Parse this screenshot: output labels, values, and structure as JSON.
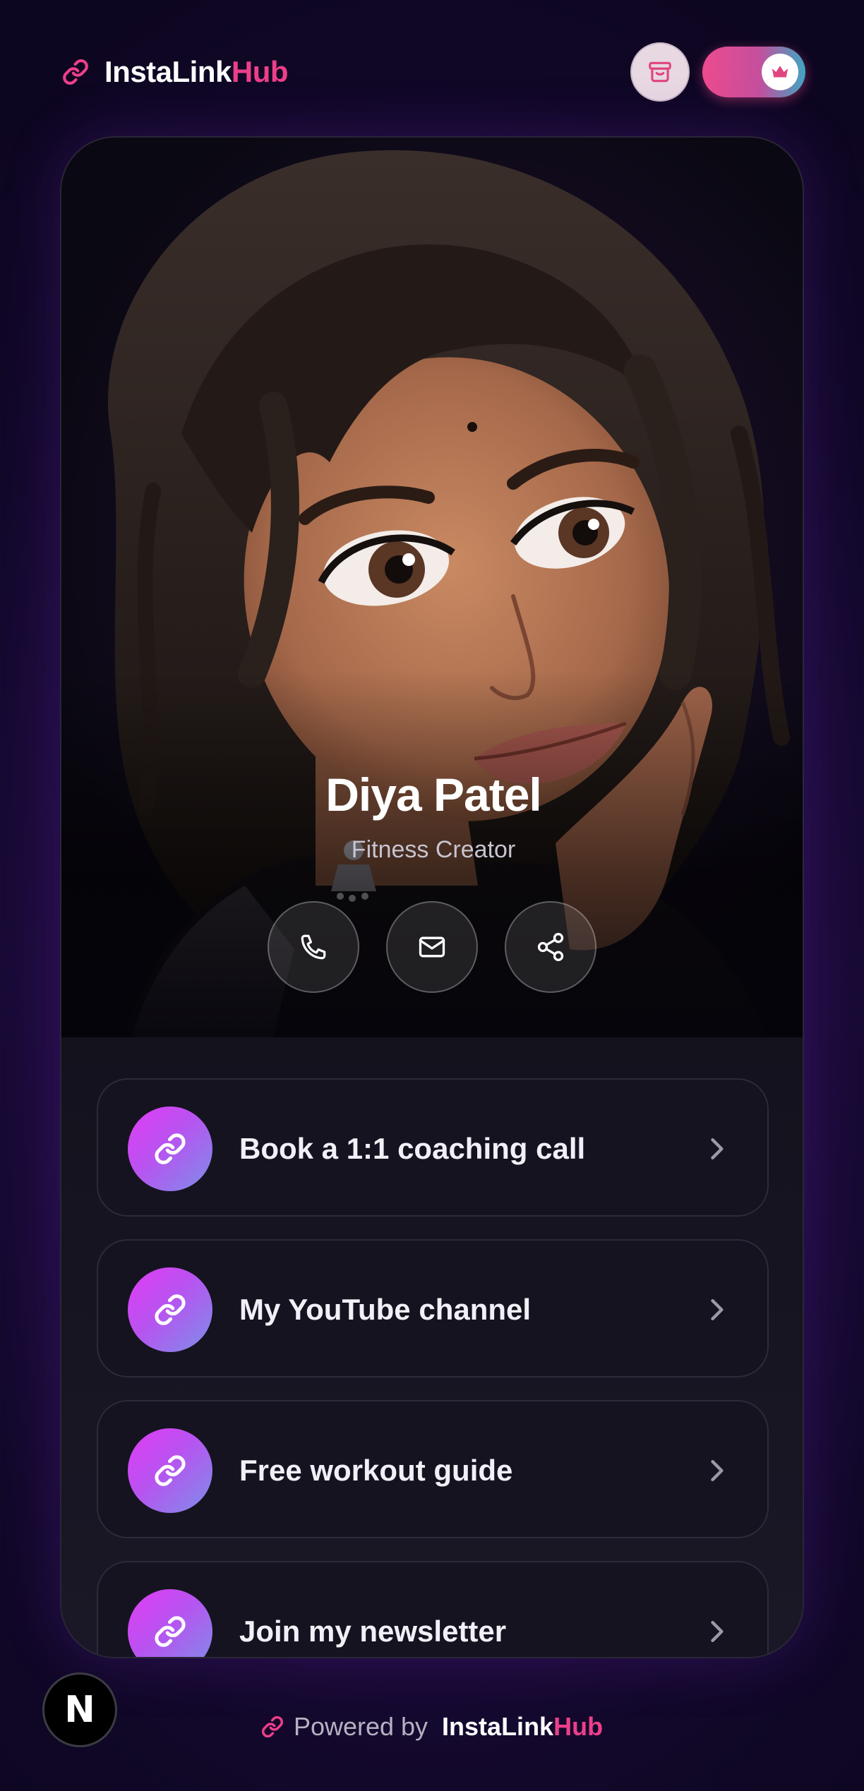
{
  "header": {
    "brand_insta": "InstaLink",
    "brand_hub": "Hub"
  },
  "profile": {
    "name": "Diya Patel",
    "subtitle": "Fitness Creator"
  },
  "actions": [
    {
      "icon": "phone-icon"
    },
    {
      "icon": "mail-icon"
    },
    {
      "icon": "share-icon"
    }
  ],
  "links": [
    {
      "label": "Book a 1:1 coaching call"
    },
    {
      "label": "My YouTube channel"
    },
    {
      "label": "Free workout guide"
    },
    {
      "label": "Join my newsletter"
    }
  ],
  "footer": {
    "powered_by": "Powered by",
    "brand_insta": "InstaLink",
    "brand_hub": "Hub",
    "badge": "N"
  },
  "colors": {
    "accent": "#ec3f8a",
    "background": "#1e0c3f",
    "card": "#15131f"
  }
}
